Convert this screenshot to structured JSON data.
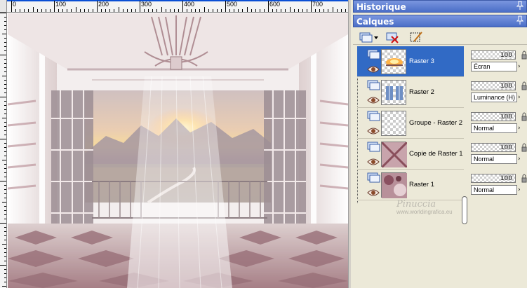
{
  "ruler": {
    "labels": [
      "0",
      "100",
      "200",
      "300",
      "400",
      "500",
      "600",
      "700"
    ]
  },
  "panels": {
    "history_title": "Historique",
    "layers_title": "Calques"
  },
  "layers": [
    {
      "name": "Raster 3",
      "opacity": "100",
      "blend": "Écran",
      "selected": true
    },
    {
      "name": "Raster 2",
      "opacity": "100",
      "blend": "Luminance (H)",
      "selected": false
    },
    {
      "name": "Groupe - Raster 2",
      "opacity": "100",
      "blend": "Normal",
      "selected": false
    },
    {
      "name": "Copie de Raster 1",
      "opacity": "100",
      "blend": "Normal",
      "selected": false
    },
    {
      "name": "Raster 1",
      "opacity": "100",
      "blend": "Normal",
      "selected": false
    }
  ],
  "watermark": {
    "name": "Pinuccia",
    "url": "www.worldingrafica.eu"
  },
  "colors": {
    "selection": "#316ac5",
    "title_bar": "#4a6ec7",
    "panel_bg": "#ece9d8"
  },
  "icons": {
    "new_layer": "new-layer-icon",
    "delete_layer": "delete-layer-icon",
    "edit_selection": "edit-selection-icon",
    "visibility": "eye-icon",
    "lock": "lock-icon",
    "pin": "pin-icon"
  }
}
